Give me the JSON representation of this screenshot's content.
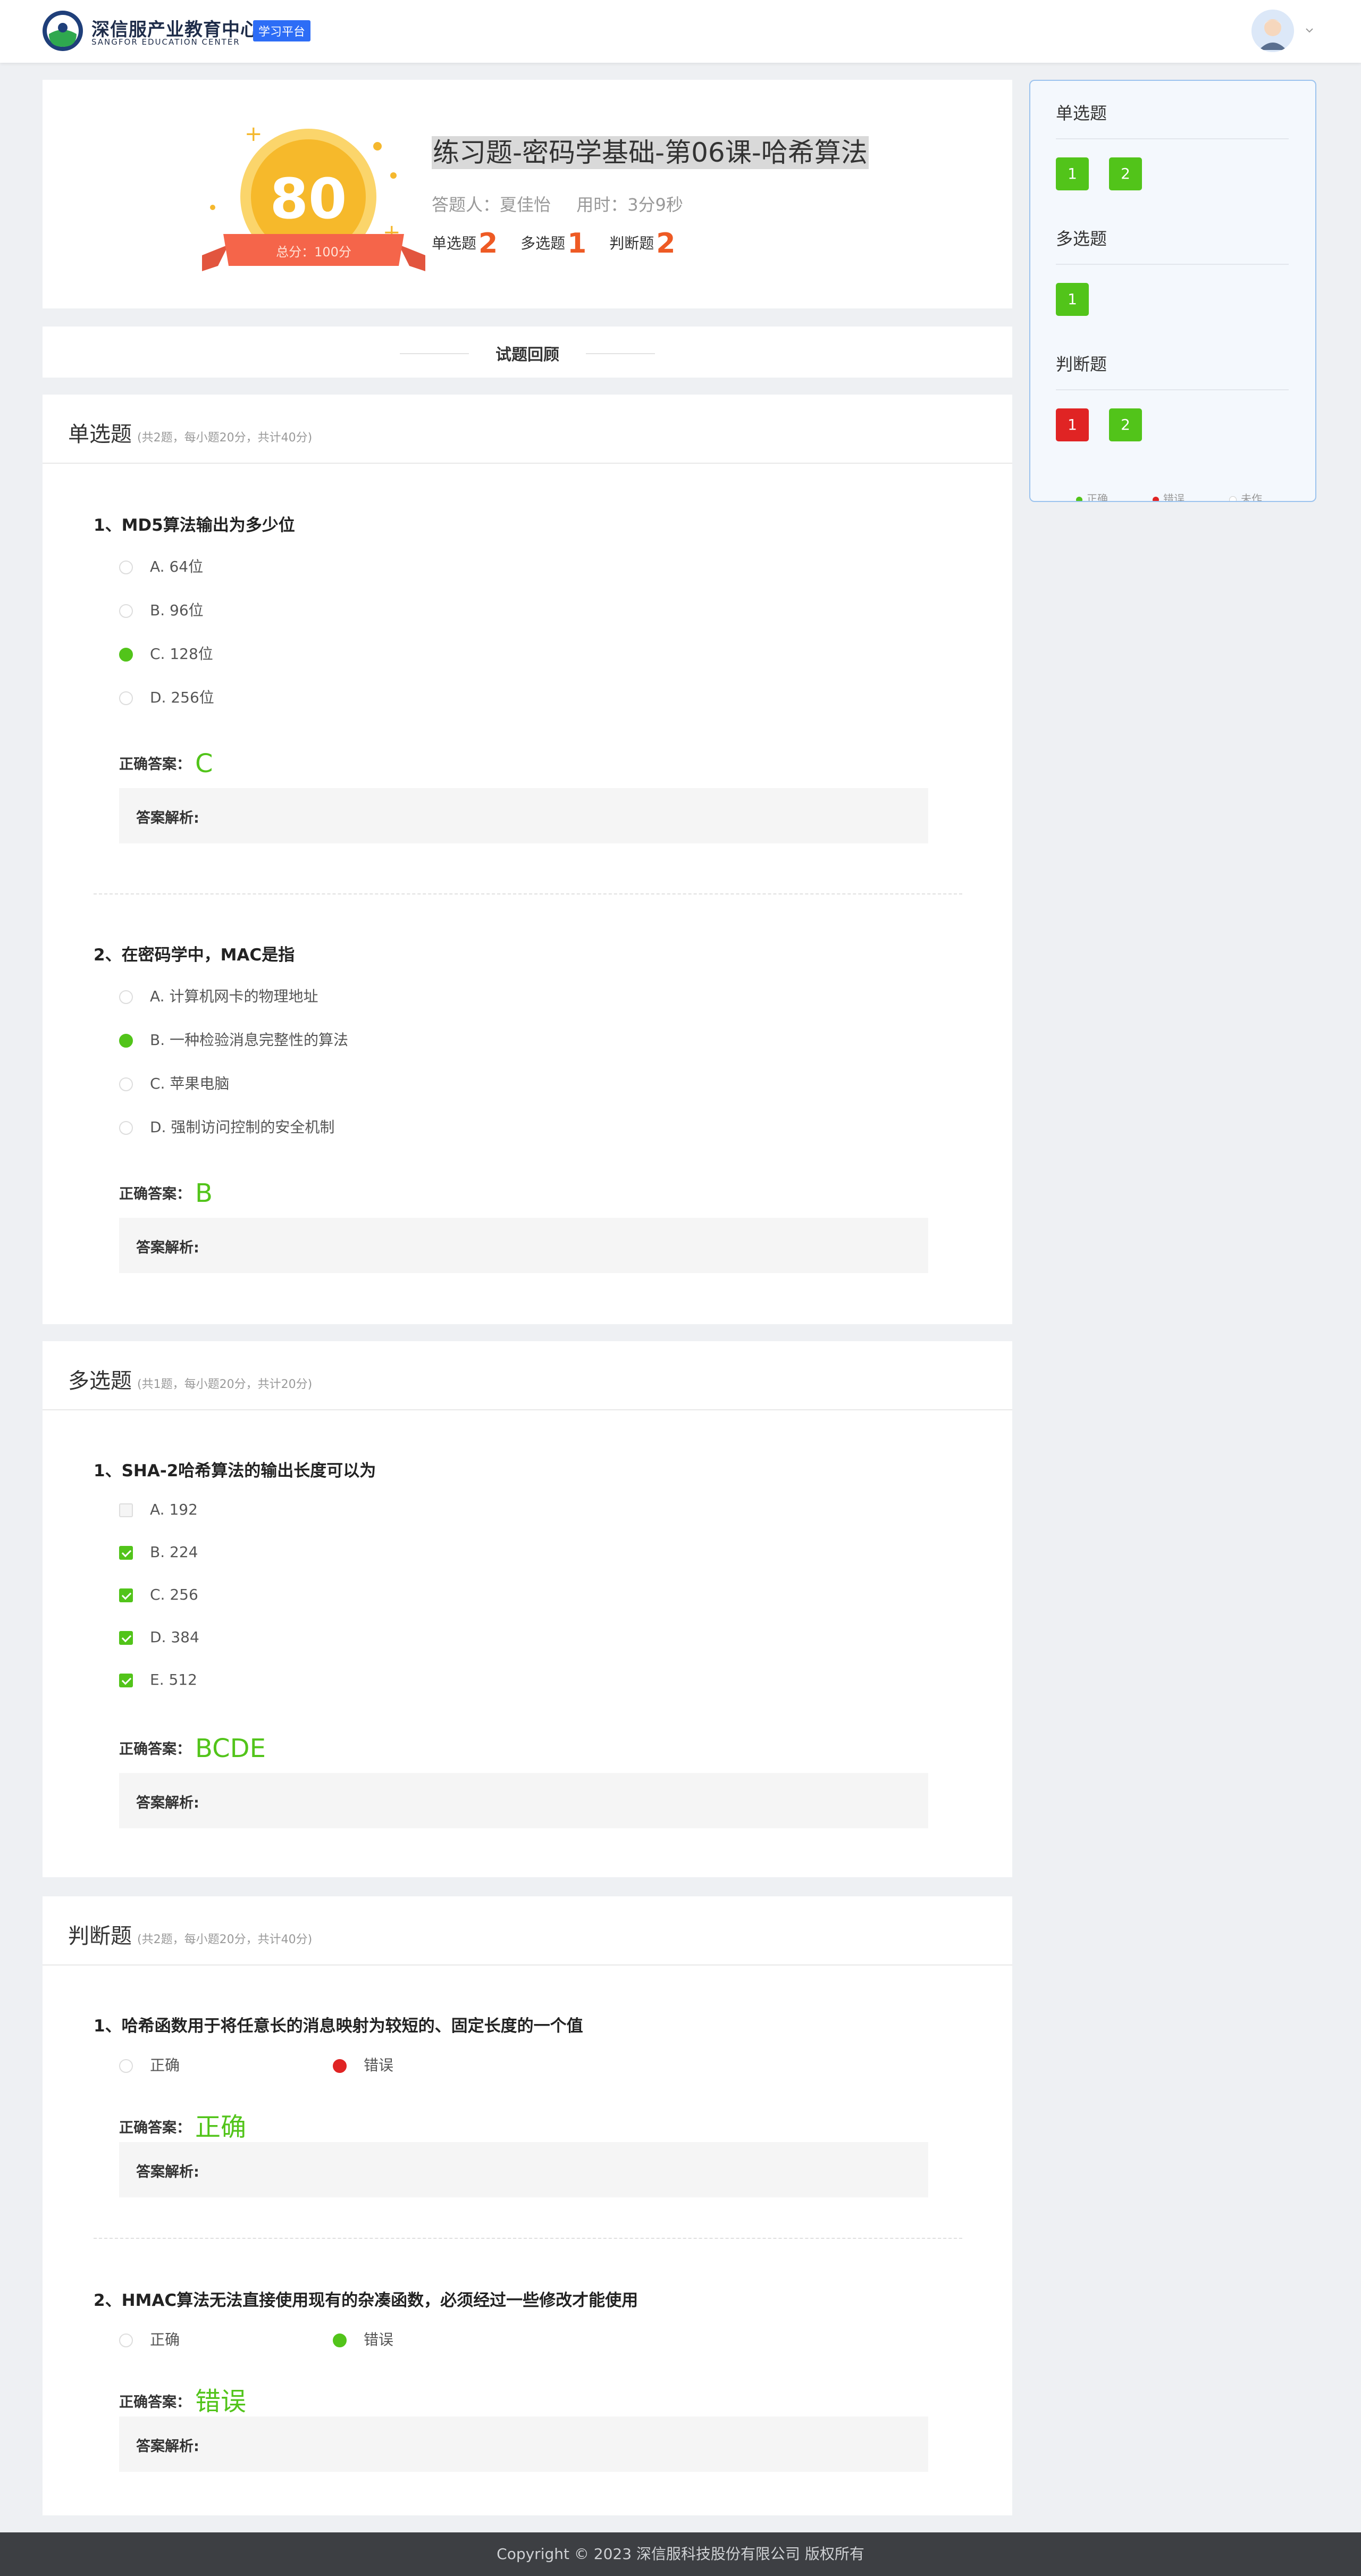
{
  "header": {
    "brand_cn": "深信服产业教育中心",
    "brand_en": "SANGFOR EDUCATION CENTER",
    "platform_tag": "学习平台"
  },
  "result": {
    "score": "80",
    "total": "总分：100分",
    "title": "练习题-密码学基础-第06课-哈希算法",
    "respondent": "答题人：夏佳怡",
    "time_used": "用时：3分9秒",
    "counts": [
      {
        "label": "单选题",
        "value": "2"
      },
      {
        "label": "多选题",
        "value": "1"
      },
      {
        "label": "判断题",
        "value": "2"
      }
    ]
  },
  "review_title": "试题回顾",
  "single": {
    "name": "单选题",
    "sub": "(共2题，每小题20分，共计40分)",
    "questions": [
      {
        "title": "1、MD5算法输出为多少位",
        "options": [
          "A. 64位",
          "B. 96位",
          "C. 128位",
          "D. 256位"
        ],
        "answer_label": "正确答案：",
        "answer": "C",
        "analysis_label": "答案解析:"
      },
      {
        "title": "2、在密码学中，MAC是指",
        "options": [
          "A. 计算机网卡的物理地址",
          "B. 一种检验消息完整性的算法",
          "C. 苹果电脑",
          "D. 强制访问控制的安全机制"
        ],
        "answer_label": "正确答案：",
        "answer": "B",
        "analysis_label": "答案解析:"
      }
    ]
  },
  "multi": {
    "name": "多选题",
    "sub": "(共1题，每小题20分，共计20分)",
    "questions": [
      {
        "title": "1、SHA-2哈希算法的输出长度可以为",
        "options": [
          "A. 192",
          "B. 224",
          "C. 256",
          "D. 384",
          "E. 512"
        ],
        "answer_label": "正确答案：",
        "answer": "BCDE",
        "analysis_label": "答案解析:"
      }
    ]
  },
  "judge": {
    "name": "判断题",
    "sub": "(共2题，每小题20分，共计40分)",
    "questions": [
      {
        "title": "1、哈希函数用于将任意长的消息映射为较短的、固定长度的一个值",
        "options": [
          "正确",
          "错误"
        ],
        "answer_label": "正确答案：",
        "answer": "正确",
        "analysis_label": "答案解析:"
      },
      {
        "title": "2、HMAC算法无法直接使用现有的杂凑函数，必须经过一些修改才能使用",
        "options": [
          "正确",
          "错误"
        ],
        "answer_label": "正确答案：",
        "answer": "错误",
        "analysis_label": "答案解析:"
      }
    ]
  },
  "side": {
    "groups": [
      {
        "title": "单选题",
        "items": [
          {
            "n": "1",
            "status": "correct"
          },
          {
            "n": "2",
            "status": "correct"
          }
        ]
      },
      {
        "title": "多选题",
        "items": [
          {
            "n": "1",
            "status": "correct"
          }
        ]
      },
      {
        "title": "判断题",
        "items": [
          {
            "n": "1",
            "status": "wrong"
          },
          {
            "n": "2",
            "status": "correct"
          }
        ]
      }
    ],
    "legend": [
      "正确",
      "错误",
      "未作"
    ]
  },
  "colors": {
    "correct": "#52c41a",
    "wrong": "#e02424",
    "accent": "#ee5a24",
    "brand": "#2d6df6"
  },
  "footer": "Copyright © 2023 深信服科技股份有限公司 版权所有"
}
